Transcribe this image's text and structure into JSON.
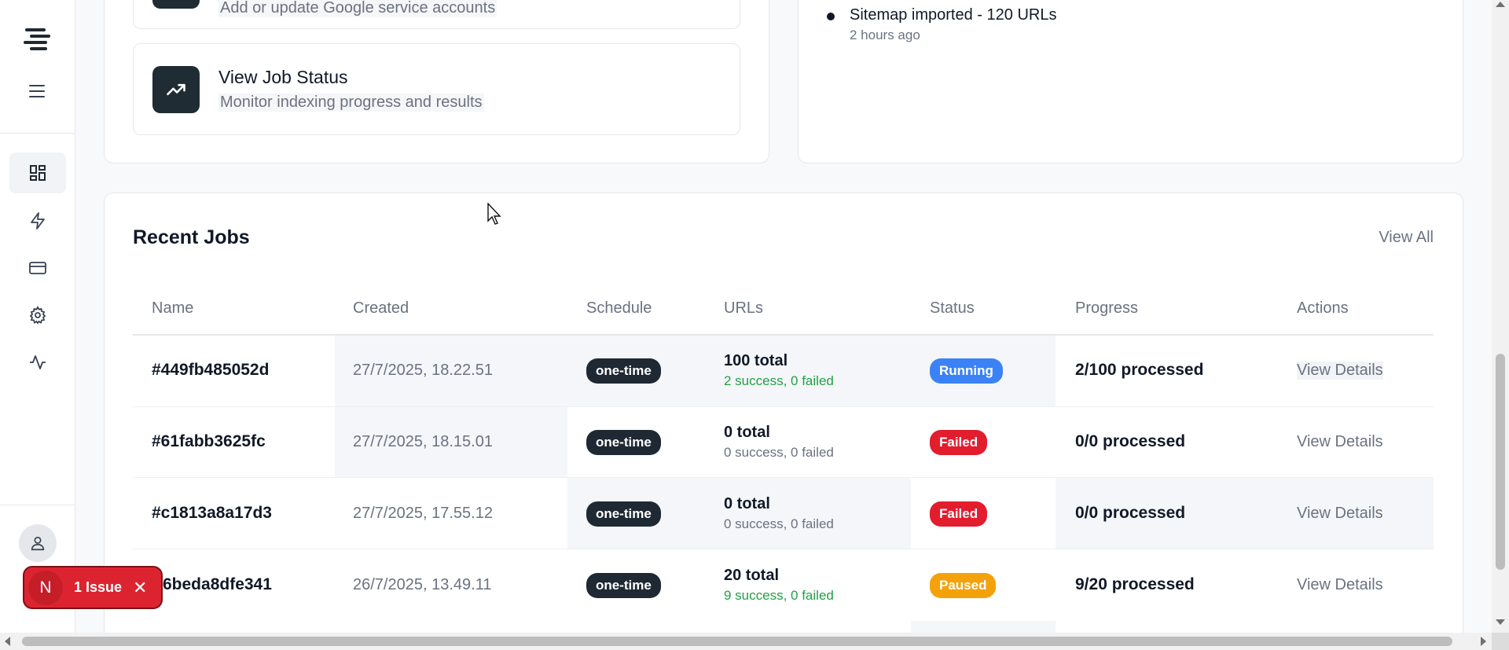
{
  "colors": {
    "accent_dark": "#1f2933",
    "running": "#3b82f6",
    "failed": "#e11d2e",
    "paused": "#f5a10a",
    "success_text": "#22a045",
    "issue": "#dc2430"
  },
  "sidebar": {
    "logo_icon": "brand-logo",
    "menu_icon": "hamburger-icon",
    "items": [
      {
        "name": "dashboard",
        "icon": "dashboard-icon",
        "active": true
      },
      {
        "name": "jobs",
        "icon": "lightning-icon",
        "active": false
      },
      {
        "name": "billing",
        "icon": "credit-card-icon",
        "active": false
      },
      {
        "name": "settings",
        "icon": "gear-icon",
        "active": false
      },
      {
        "name": "activity",
        "icon": "pulse-icon",
        "active": false
      }
    ],
    "avatar_icon": "user-icon"
  },
  "quick_actions": [
    {
      "title": "",
      "description": "Add or update Google service accounts"
    },
    {
      "title": "View Job Status",
      "description": "Monitor indexing progress and results",
      "icon": "trending-up-icon"
    }
  ],
  "activity": {
    "items": [
      {
        "title": "Sitemap imported - 120 URLs",
        "time": "2 hours ago"
      }
    ]
  },
  "recent_jobs": {
    "title": "Recent Jobs",
    "view_all": "View All",
    "columns": [
      "Name",
      "Created",
      "Schedule",
      "URLs",
      "Status",
      "Progress",
      "Actions"
    ],
    "rows": [
      {
        "name": "#449fb485052d",
        "created": "27/7/2025, 18.22.51",
        "schedule": "one-time",
        "urls_total": "100 total",
        "urls_detail": "2 success, 0 failed",
        "detail_color": "green",
        "status": "Running",
        "status_color": "#3b82f6",
        "progress": "2/100 processed",
        "action": "View Details"
      },
      {
        "name": "#61fabb3625fc",
        "created": "27/7/2025, 18.15.01",
        "schedule": "one-time",
        "urls_total": "0 total",
        "urls_detail": "0 success, 0 failed",
        "detail_color": "gray",
        "status": "Failed",
        "status_color": "#e11d2e",
        "progress": "0/0 processed",
        "action": "View Details"
      },
      {
        "name": "#c1813a8a17d3",
        "created": "27/7/2025, 17.55.12",
        "schedule": "one-time",
        "urls_total": "0 total",
        "urls_detail": "0 success, 0 failed",
        "detail_color": "gray",
        "status": "Failed",
        "status_color": "#e11d2e",
        "progress": "0/0 processed",
        "action": "View Details"
      },
      {
        "name": "6beda8dfe341",
        "created": "26/7/2025, 13.49.11",
        "schedule": "one-time",
        "urls_total": "20 total",
        "urls_detail": "9 success, 0 failed",
        "detail_color": "green",
        "status": "Paused",
        "status_color": "#f5a10a",
        "progress": "9/20 processed",
        "action": "View Details"
      }
    ]
  },
  "issue_toast": {
    "avatar_letter": "N",
    "label": "1 Issue",
    "close_icon": "close-icon"
  }
}
